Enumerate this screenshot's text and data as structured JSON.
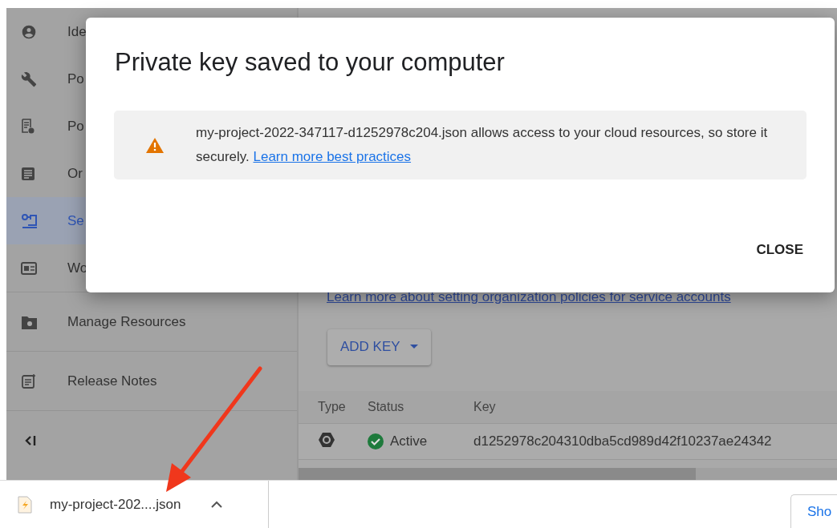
{
  "sidebar": {
    "items": [
      {
        "label": "Ide",
        "selected": false
      },
      {
        "label": "Po",
        "selected": false
      },
      {
        "label": "Po",
        "selected": false
      },
      {
        "label": "Or",
        "selected": false
      },
      {
        "label": "Se",
        "selected": true
      },
      {
        "label": "Wo",
        "selected": false
      }
    ],
    "footer_items": [
      {
        "label": "Manage Resources"
      },
      {
        "label": "Release Notes"
      }
    ]
  },
  "main": {
    "policy_link": "Learn more about setting organization policies for service accounts",
    "add_key_button": "ADD KEY",
    "table": {
      "columns": [
        "Type",
        "Status",
        "Key"
      ],
      "rows": [
        {
          "status": "Active",
          "key": "d1252978c204310dba5cd989d42f10237ae24342"
        }
      ]
    }
  },
  "dialog": {
    "title": "Private key saved to your computer",
    "warning": {
      "text": "my-project-2022-347117-d1252978c204.json allows access to your cloud resources, so store it securely.",
      "link": "Learn more best practices"
    },
    "buttons": [
      "CLOSE"
    ]
  },
  "download_bar": {
    "file_name": "my-project-202....json",
    "show_button": "Sho"
  }
}
